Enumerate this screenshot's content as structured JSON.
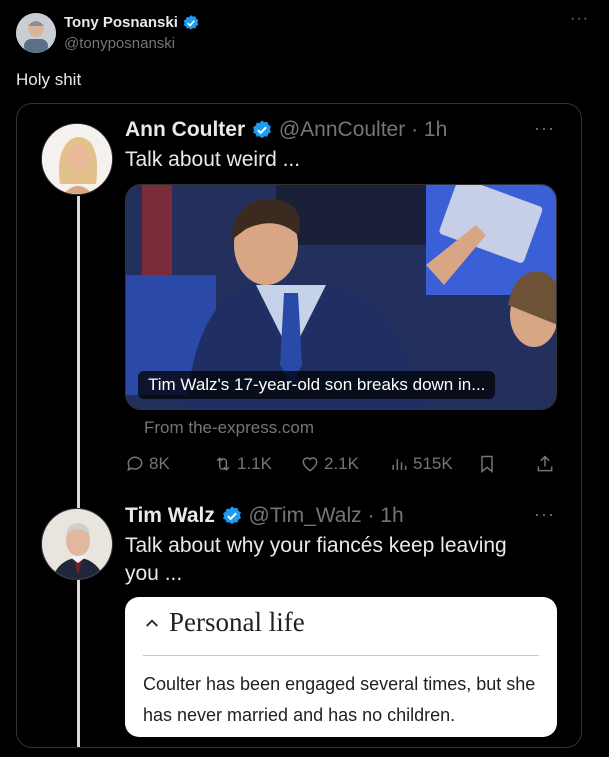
{
  "outer": {
    "name": "Tony Posnanski",
    "handle": "@tonyposnanski",
    "text": "Holy shit",
    "more": "···"
  },
  "quoted": {
    "name": "Ann Coulter",
    "handle": "@AnnCoulter",
    "time": "· 1h",
    "text": "Talk about weird ...",
    "more": "···",
    "media_caption": "Tim Walz's 17-year-old son breaks down in...",
    "link_source": "From the-express.com",
    "actions": {
      "replies": "8K",
      "reposts": "1.1K",
      "likes": "2.1K",
      "views": "515K"
    }
  },
  "reply": {
    "name": "Tim Walz",
    "handle": "@Tim_Walz",
    "time": "· 1h",
    "text": "Talk about why your fiancés keep leaving you ...",
    "more": "···",
    "wiki": {
      "heading": "Personal life",
      "body": "Coulter has been engaged several times, but she has never married and has no children."
    }
  },
  "colors": {
    "background": "#000000",
    "verified": "#1d9bf0",
    "muted": "#71767b"
  }
}
